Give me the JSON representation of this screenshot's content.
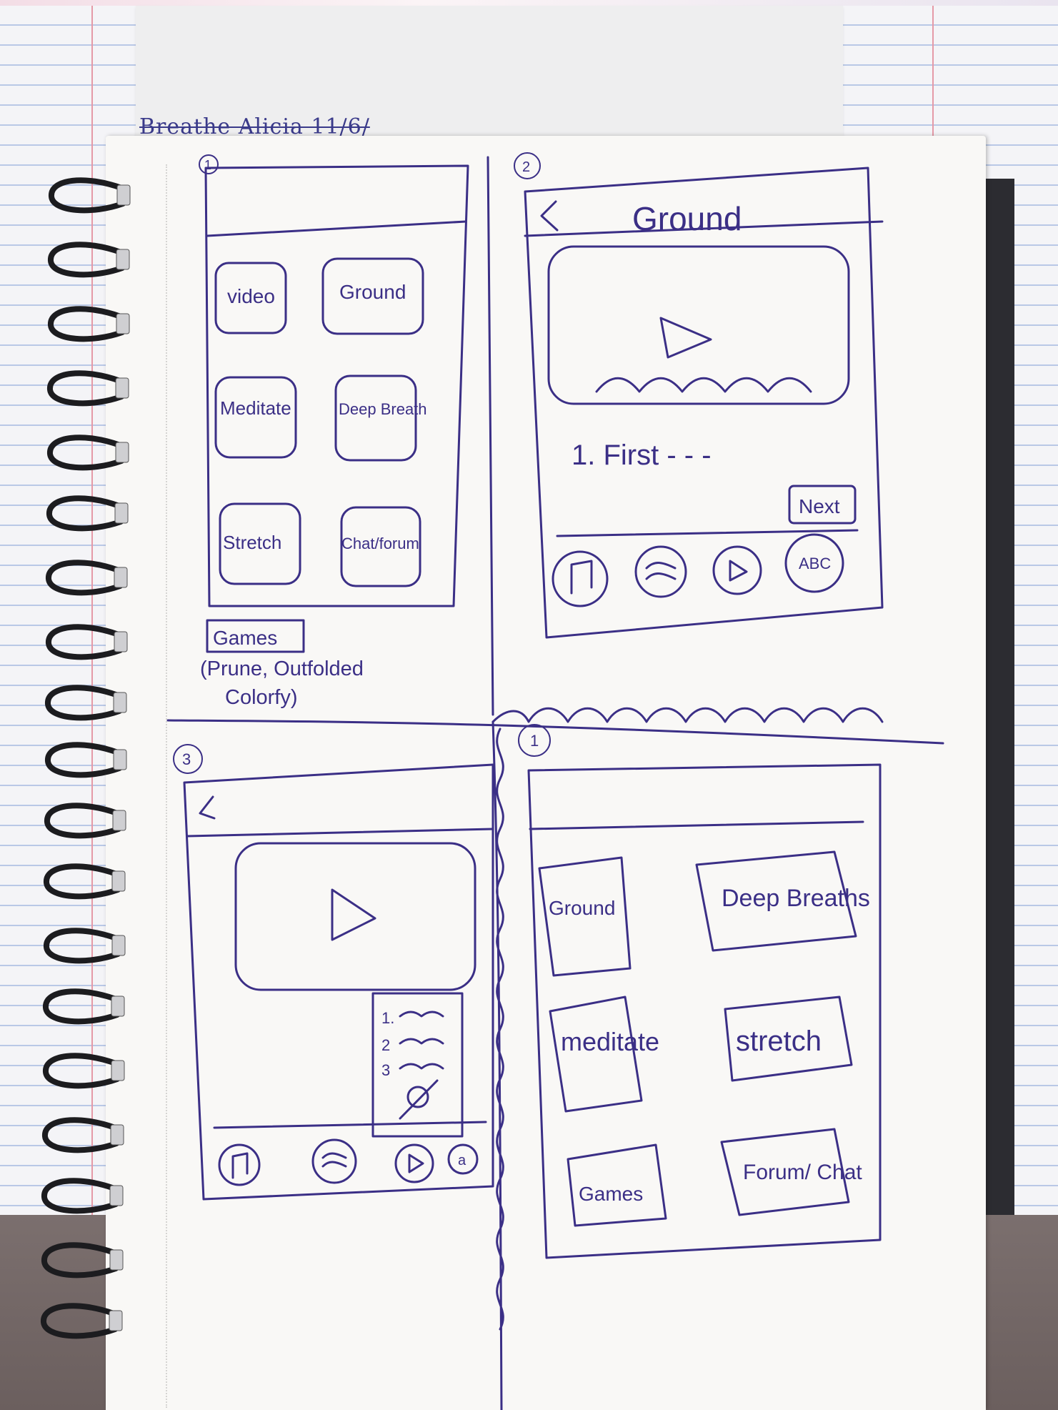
{
  "background_notebook": {
    "top_caption": "Breathe Alicia  11/6/"
  },
  "panel_1": {
    "number": "1",
    "tiles": [
      "video",
      "Ground",
      "Meditate",
      "Deep Breath",
      "Stretch",
      "Chat/forum"
    ],
    "games_box": "Games",
    "games_note_line1": "(Prune, Outfolded",
    "games_note_line2": "Colorfy)"
  },
  "panel_2": {
    "number": "2",
    "back_glyph": "<",
    "title": "Ground",
    "step_text": "1. First - - -",
    "next_button": "Next",
    "nav_icons": [
      "music-note-icon",
      "waves-icon",
      "play-icon",
      "abc-icon"
    ],
    "nav_abc_label": "ABC"
  },
  "panel_3": {
    "number": "3",
    "back_glyph": "<",
    "list_items": [
      "1.",
      "2",
      "3"
    ],
    "nav_icons": [
      "music-note-icon",
      "waves-icon",
      "play-icon",
      "a-icon"
    ],
    "nav_a_label": "a"
  },
  "panel_4": {
    "number": "1",
    "tiles": [
      "Ground",
      "Deep Breaths",
      "meditate",
      "stretch",
      "Games",
      "Forum/ Chat"
    ]
  },
  "colors": {
    "ink": "#3b2f86",
    "paper": "#f9f8f6",
    "spiral": "#1c1c1f"
  }
}
